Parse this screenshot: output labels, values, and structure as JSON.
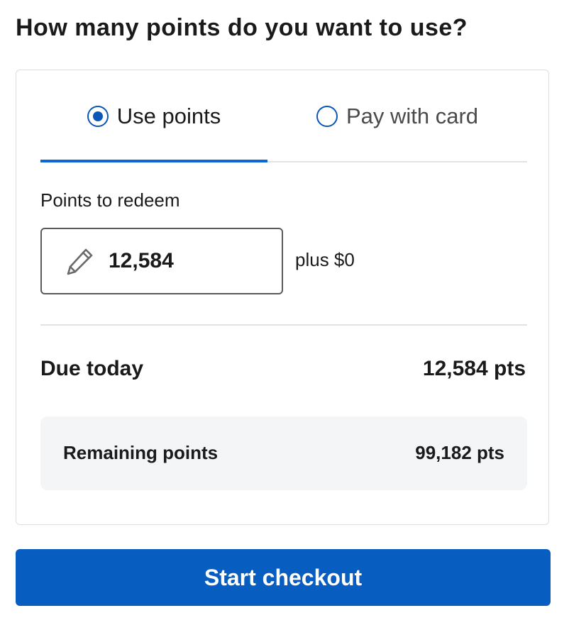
{
  "page": {
    "heading": "How many points do you want to use?"
  },
  "tabs": [
    {
      "label": "Use points",
      "selected": true
    },
    {
      "label": "Pay with card",
      "selected": false
    }
  ],
  "redeem": {
    "label": "Points to redeem",
    "value": "12,584",
    "plus_text": "plus $0",
    "icon": "pencil-icon"
  },
  "summary": {
    "due_label": "Due today",
    "due_value": "12,584 pts",
    "remaining_label": "Remaining points",
    "remaining_value": "99,182 pts"
  },
  "actions": {
    "checkout_label": "Start checkout"
  },
  "colors": {
    "accent": "#0b66d6",
    "button": "#075ec0",
    "radio": "#0b57b8",
    "remaining_bg": "#f4f5f7"
  }
}
